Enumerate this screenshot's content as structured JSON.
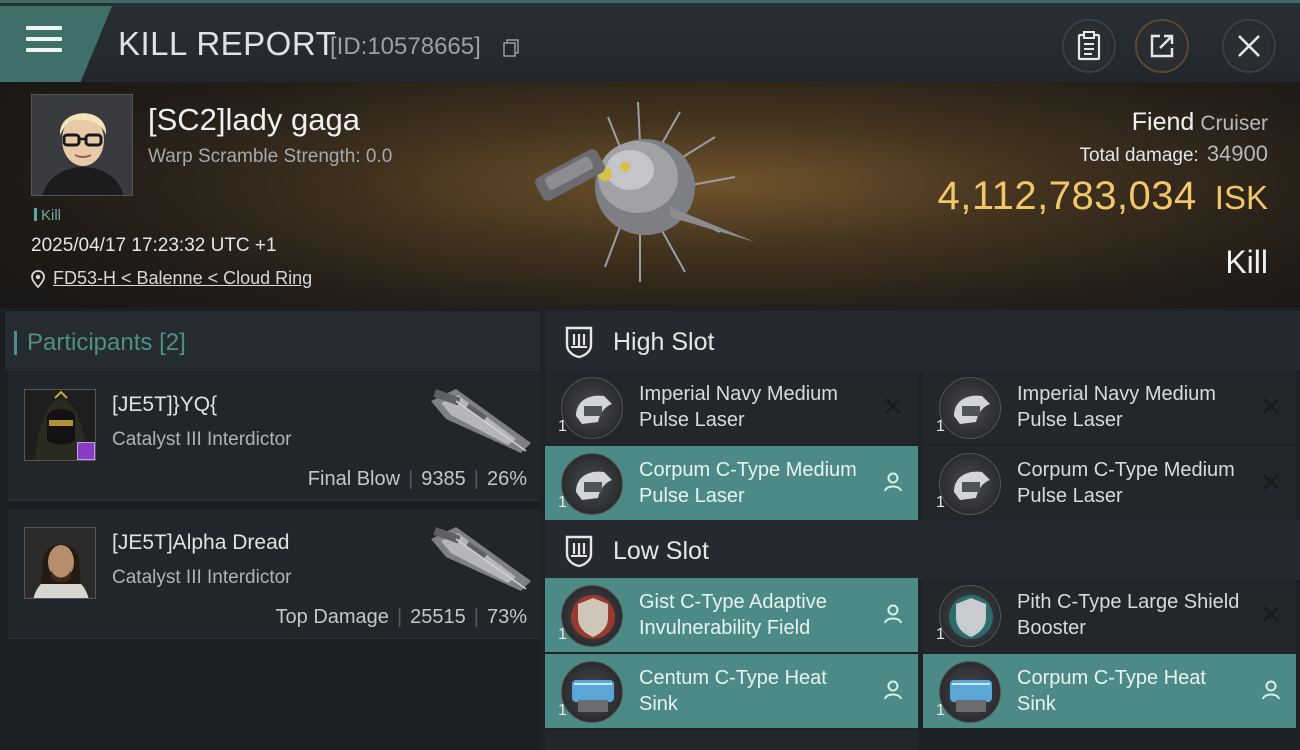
{
  "header": {
    "title": "KILL REPORT",
    "report_id": "[ID:10578665]"
  },
  "victim": {
    "name": "[SC2]lady gaga",
    "warp_strength": "Warp Scramble Strength: 0.0",
    "kill_tag": "Kill",
    "datetime": "2025/04/17 17:23:32 UTC +1",
    "location": "FD53-H < Balenne < Cloud Ring",
    "ship_name": "Fiend",
    "ship_class": "Cruiser",
    "damage_label": "Total damage:",
    "damage_value": "34900",
    "isk_value": "4,112,783,034",
    "isk_unit": "ISK",
    "result": "Kill"
  },
  "participants": {
    "title": "Participants",
    "count": "[2]",
    "rows": [
      {
        "name": "[JE5T]}YQ{",
        "ship": "Catalyst III Interdictor",
        "role": "Final Blow",
        "damage": "9385",
        "percent": "26%"
      },
      {
        "name": "[JE5T]Alpha Dread",
        "ship": "Catalyst III Interdictor",
        "role": "Top Damage",
        "damage": "25515",
        "percent": "73%"
      }
    ]
  },
  "fitting": {
    "high_slot_label": "High Slot",
    "low_slot_label": "Low Slot",
    "high": [
      {
        "qty": "1",
        "name": "Imperial Navy Medium Pulse Laser",
        "icon": "pulse-laser-icon",
        "action": "x"
      },
      {
        "qty": "1",
        "name": "Imperial Navy Medium Pulse Laser",
        "icon": "pulse-laser-icon",
        "action": "x"
      },
      {
        "qty": "1",
        "name": "Corpum C-Type Medium Pulse Laser",
        "icon": "pulse-laser-icon",
        "action": "person"
      },
      {
        "qty": "1",
        "name": "Corpum C-Type Medium Pulse Laser",
        "icon": "pulse-laser-icon",
        "action": "x"
      }
    ],
    "low": [
      {
        "qty": "1",
        "name": "Gist C-Type Adaptive Invulnerability Field",
        "icon": "shield-field-icon",
        "action": "person"
      },
      {
        "qty": "1",
        "name": "Pith C-Type Large Shield Booster",
        "icon": "shield-booster-icon",
        "action": "x"
      },
      {
        "qty": "1",
        "name": "Centum C-Type Heat Sink",
        "icon": "heat-sink-icon",
        "action": "person"
      },
      {
        "qty": "1",
        "name": "Corpum C-Type Heat Sink",
        "icon": "heat-sink-icon",
        "action": "person"
      }
    ]
  },
  "colors": {
    "accent": "#4c8b85",
    "isk_gold": "#f3c66a",
    "badge_purple": "#8b3cc4"
  }
}
